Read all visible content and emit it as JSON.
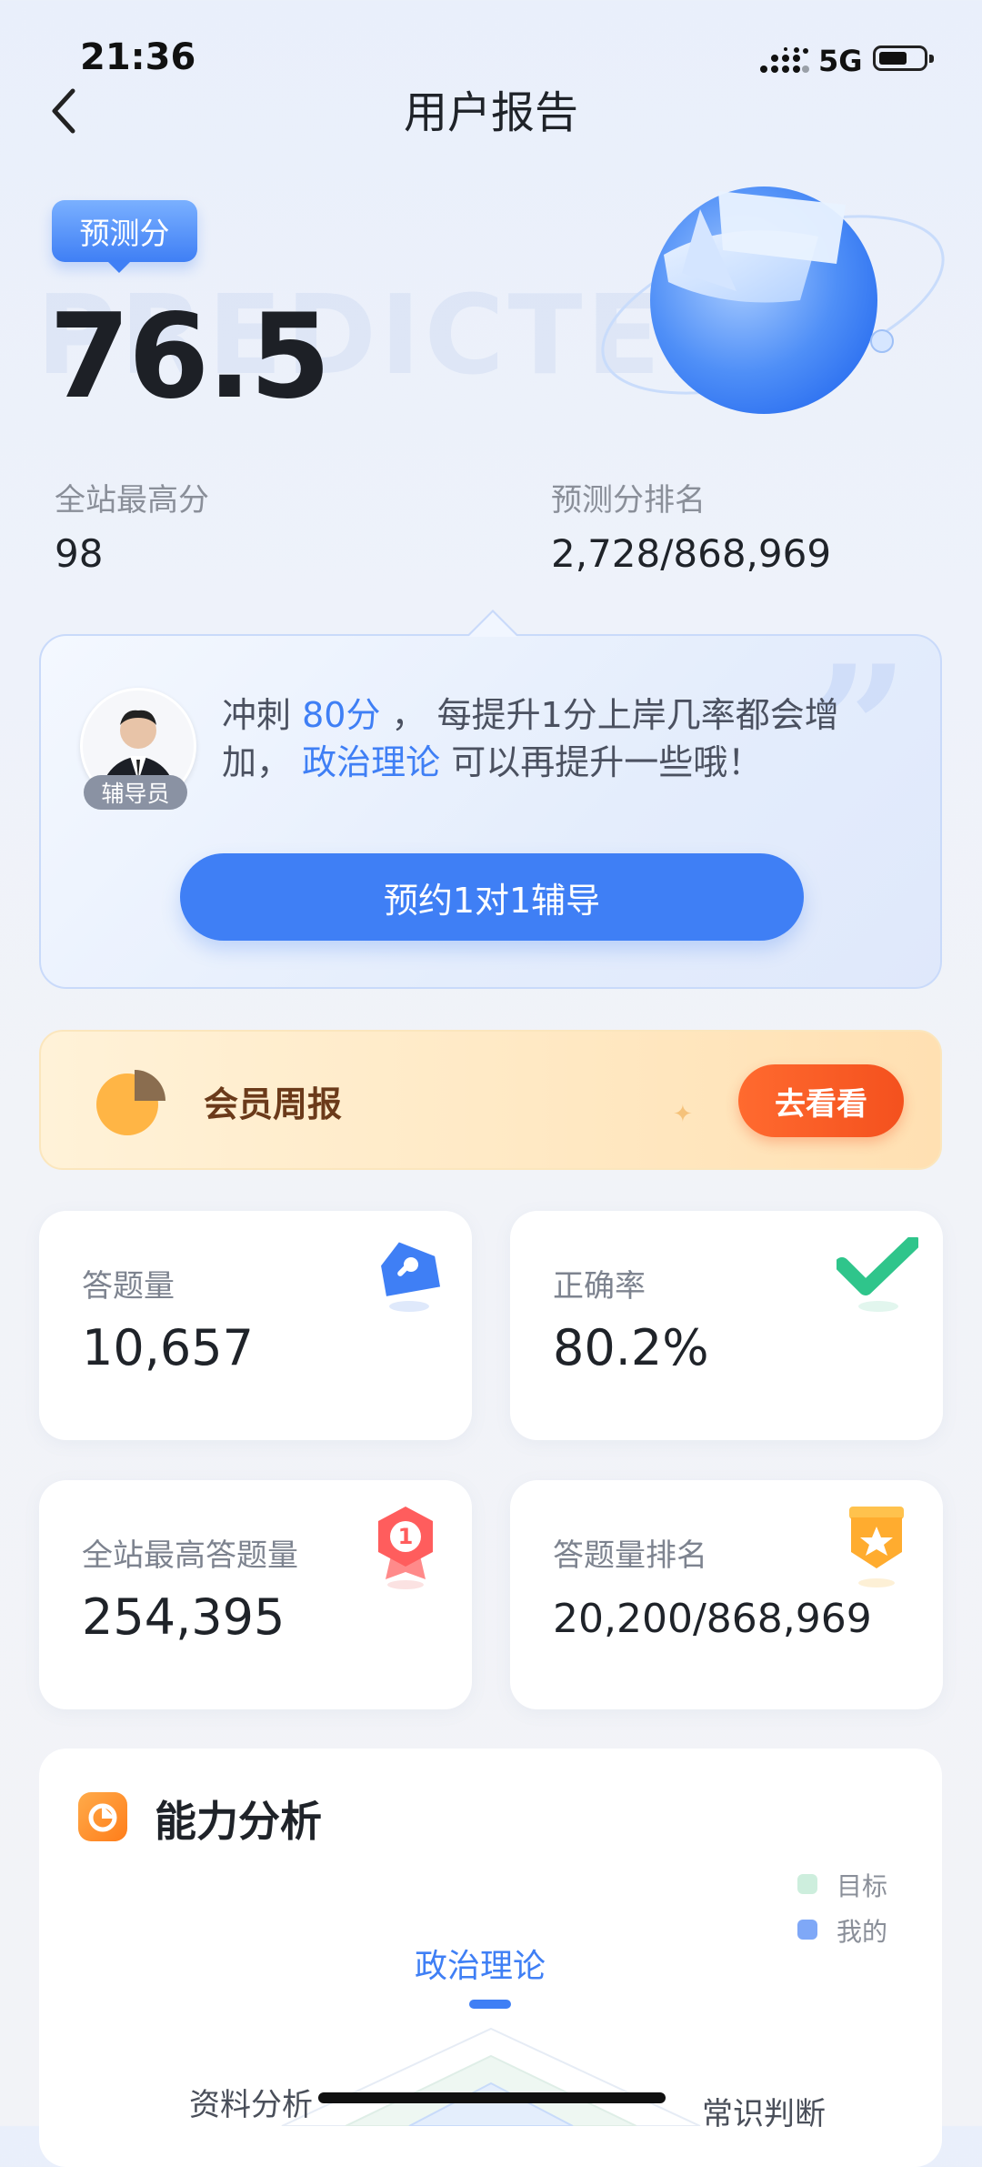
{
  "status_bar": {
    "time": "21:36",
    "network": "5G"
  },
  "header": {
    "title": "用户报告"
  },
  "hero": {
    "badge": "预测分",
    "watermark": "PREDICTED",
    "score": "76.5",
    "stats": [
      {
        "label": "全站最高分",
        "value": "98"
      },
      {
        "label": "预测分排名",
        "value": "2,728/868,969"
      }
    ]
  },
  "tutor": {
    "avatar_tag": "辅导员",
    "text_parts": [
      "冲刺 ",
      "80分",
      " ， 每提升1分上岸几率都会增加， ",
      "政治理论",
      " 可以再提升一些哦！"
    ],
    "cta_label": "预约1对1辅导"
  },
  "weekly": {
    "label": "会员周报",
    "button_label": "去看看"
  },
  "stat_cards": [
    {
      "label": "答题量",
      "value": "10,657",
      "icon": "pencil-icon"
    },
    {
      "label": "正确率",
      "value": "80.2%",
      "icon": "checkmark-icon"
    },
    {
      "label": "全站最高答题量",
      "value": "254,395",
      "icon": "rank-first-icon"
    },
    {
      "label": "答题量排名",
      "value": "20,200/868,969",
      "icon": "medal-star-icon"
    }
  ],
  "ability": {
    "title": "能力分析",
    "legend": [
      {
        "label": "目标",
        "color": "#cdeedd"
      },
      {
        "label": "我的",
        "color": "#7fa8f7"
      }
    ],
    "categories": {
      "top": "政治理论",
      "left": "资料分析",
      "right": "常识判断"
    }
  },
  "colors": {
    "accent": "#3f7ff5",
    "orange": "#f4511e",
    "text": "#1f2329",
    "muted": "#8a8f99"
  }
}
